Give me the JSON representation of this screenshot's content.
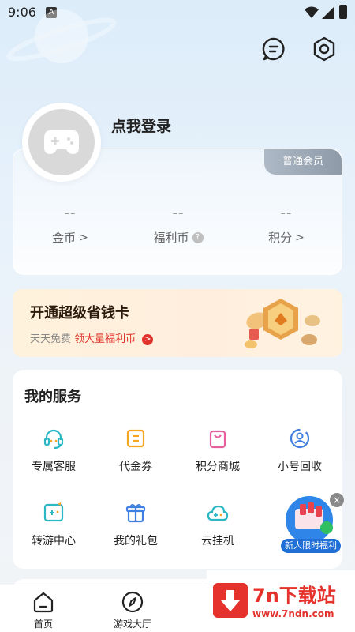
{
  "status_bar": {
    "time": "9:06",
    "a_icon": "A"
  },
  "header": {
    "message_icon": "message-icon",
    "settings_icon": "settings-icon"
  },
  "profile": {
    "login_text": "点我登录",
    "avatar_icon": "gamepad-icon"
  },
  "member_card": {
    "badge": "普通会员",
    "stats": [
      {
        "value": "--",
        "label": "金币",
        "suffix": ">"
      },
      {
        "value": "--",
        "label": "福利币",
        "suffix": "?"
      },
      {
        "value": "--",
        "label": "积分",
        "suffix": ">"
      }
    ]
  },
  "promo": {
    "title": "开通超级省钱卡",
    "sub_plain": "天天免费",
    "sub_highlight": "领大量福利币",
    "arrow": ">"
  },
  "services": {
    "title": "我的服务",
    "items": [
      {
        "label": "专属客服",
        "icon": "headset-icon"
      },
      {
        "label": "代金券",
        "icon": "coupon-icon"
      },
      {
        "label": "积分商城",
        "icon": "shopping-bag-icon"
      },
      {
        "label": "小号回收",
        "icon": "recycle-user-icon"
      },
      {
        "label": "转游中心",
        "icon": "game-transfer-icon"
      },
      {
        "label": "我的礼包",
        "icon": "gift-icon"
      },
      {
        "label": "云挂机",
        "icon": "cloud-game-icon"
      }
    ]
  },
  "float_ad": {
    "label": "新人限时福利",
    "close": "×"
  },
  "bottom_nav": [
    {
      "label": "首页",
      "icon": "home-icon"
    },
    {
      "label": "游戏大厅",
      "icon": "compass-icon"
    }
  ],
  "watermark": {
    "title": "7n下载站",
    "url": "www.7ndn.com"
  },
  "colors": {
    "accent_teal": "#2bb7c4",
    "accent_orange": "#f5a623",
    "accent_pink": "#e85fa0",
    "accent_blue": "#3f7fe0",
    "promo_red": "#e0322b"
  }
}
